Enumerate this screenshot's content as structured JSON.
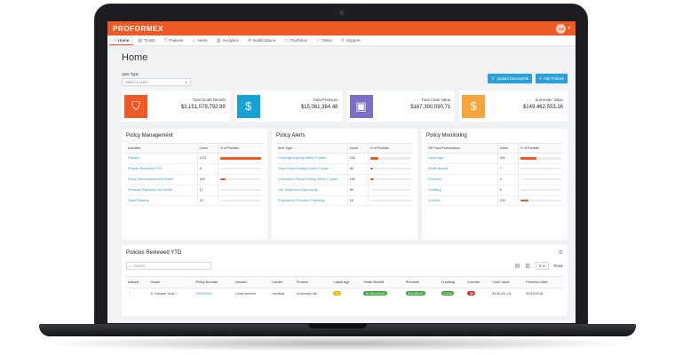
{
  "header": {
    "brand": "PROFORMEX",
    "user_initials": "UM"
  },
  "nav": [
    {
      "label": "Home",
      "icon": "home-icon",
      "glyph": "⌂",
      "active": true
    },
    {
      "label": "Trusts",
      "icon": "document-icon",
      "glyph": "▤"
    },
    {
      "label": "Policies",
      "icon": "shield-icon",
      "glyph": "⛉"
    },
    {
      "label": "Alerts",
      "icon": "bell-icon",
      "glyph": "♫"
    },
    {
      "label": "Analytics",
      "icon": "chart-icon",
      "glyph": "▥"
    },
    {
      "label": "Notifications",
      "icon": "envelope-icon",
      "glyph": "✉"
    },
    {
      "label": "Portfolios",
      "icon": "folder-icon",
      "glyph": "▭"
    },
    {
      "label": "Tasks",
      "icon": "check-icon",
      "glyph": "✓"
    },
    {
      "label": "Support",
      "icon": "support-icon",
      "glyph": "⚲"
    }
  ],
  "page": {
    "title": "Home"
  },
  "filter": {
    "label": "User Type",
    "placeholder": "Select a User"
  },
  "buttons": {
    "upload": "Upload Documents",
    "add": "Add Policies"
  },
  "kpis": [
    {
      "label": "Total Death Benefit",
      "value": "$3,151,079,792.99",
      "color": "#ef5a24",
      "icon": "shield-icon",
      "glyph": "⛉"
    },
    {
      "label": "Total Premium",
      "value": "$15,061,364.48",
      "color": "#17a2d4",
      "icon": "invoice-icon",
      "glyph": "$"
    },
    {
      "label": "Total Cash Value",
      "value": "$167,390,090.71",
      "color": "#7b6fc8",
      "icon": "wallet-icon",
      "glyph": "▣"
    },
    {
      "label": "Surrender Value",
      "value": "$149,462,553.16",
      "color": "#f4a63c",
      "icon": "money-hand-icon",
      "glyph": "$"
    }
  ],
  "panels": {
    "management": {
      "title": "Policy Management",
      "headers": [
        "Activities",
        "Count",
        "% of Portfolio"
      ],
      "rows": [
        {
          "label": "Policies",
          "count": "1131",
          "pct": 1.0
        },
        {
          "label": "Policies Reviewed YTD",
          "count": "8",
          "pct": 0.0
        },
        {
          "label": "Policy Anniversaries this Month",
          "count": "163",
          "pct": 0.14
        },
        {
          "label": "Premium Payments this Month",
          "count": "17",
          "pct": 0.0
        },
        {
          "label": "Open Reviews",
          "count": "13",
          "pct": 0.0
        }
      ]
    },
    "alerts": {
      "title": "Policy Alerts",
      "headers": [
        "Alert Type",
        "Count",
        "% of Portfolio"
      ],
      "rows": [
        {
          "label": "Coverage Lapsing Within 5 years",
          "count": "245",
          "pct": 0.21
        },
        {
          "label": "Term Period Ending Within 2 years",
          "count": "86",
          "pct": 0.08
        },
        {
          "label": "Conversion Period Ending Within 2 years",
          "count": "106",
          "pct": 0.09
        },
        {
          "label": "Life Settlement Opportunity",
          "count": "88",
          "pct": 0.0
        },
        {
          "label": "Potential for Premium Financing",
          "count": "18",
          "pct": 0.0
        }
      ]
    },
    "monitoring": {
      "title": "Policy Monitoring",
      "headers": [
        "Off Track Performance",
        "Count",
        "% of Portfolio"
      ],
      "rows": [
        {
          "label": "Lapse Age",
          "count": "440",
          "pct": 0.39
        },
        {
          "label": "Death Benefit",
          "count": "7",
          "pct": 0.0
        },
        {
          "label": "Premium",
          "count": "9",
          "pct": 0.0
        },
        {
          "label": "Crediting",
          "count": "6",
          "pct": 0.0
        },
        {
          "label": "Comdex",
          "count": "240",
          "pct": 0.21
        }
      ]
    }
  },
  "reviewed": {
    "title": "Policies Reviewed YTD",
    "search_placeholder": "Search",
    "rows_value": "5",
    "rows_label": "Rows",
    "headers": [
      "Actions",
      "Owner",
      "Policy Number",
      "Insured",
      "Carrier",
      "Product",
      "Lapse Age",
      "Death Benefit",
      "Premium",
      "Crediting",
      "Comdex",
      "Cash Value",
      "Premium Date"
    ],
    "rows": [
      {
        "actions": "⋮",
        "owner": "A. Sample Trust I",
        "policy_number": "JN050000",
        "insured": "Linda Insured",
        "carrier": "Hartford",
        "product": "Universal Life",
        "lapse_age": "93",
        "death_benefit": "$2,000,000.00",
        "premium": "$16,858.45",
        "crediting": "4.00%",
        "comdex": "58",
        "cash_value": "$136,111.15",
        "premium_date": "09/13/2018"
      }
    ]
  }
}
